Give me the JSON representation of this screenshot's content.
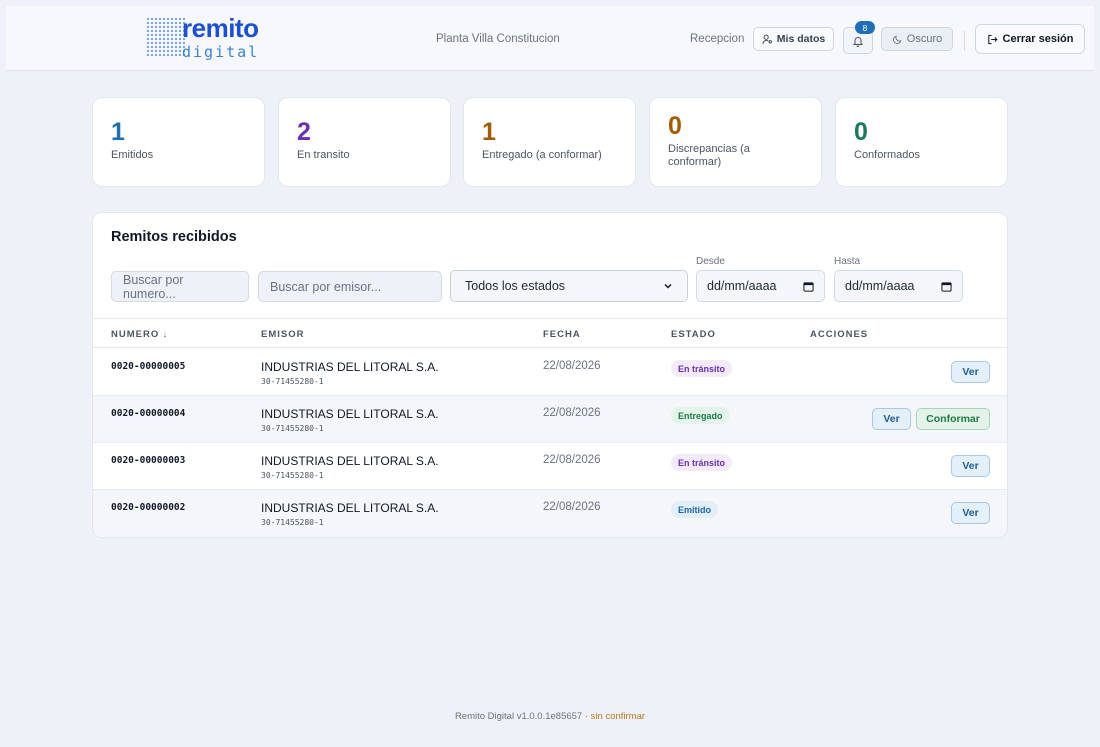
{
  "header": {
    "logo_main": "remito",
    "logo_sub": "digital",
    "plant": "Planta Villa Constitucion",
    "role": "Recepcion",
    "mis_datos": "Mis datos",
    "notifications": "8",
    "theme": "Oscuro",
    "logout": "Cerrar sesión"
  },
  "stats": [
    {
      "value": "1",
      "label": "Emitidos",
      "color": "#1f6fb3"
    },
    {
      "value": "2",
      "label": "En transito",
      "color": "#6b2fb3"
    },
    {
      "value": "1",
      "label": "Entregado (a conformar)",
      "color": "#a15c07"
    },
    {
      "value": "0",
      "label": "Discrepancias (a conformar)",
      "color": "#a15c07"
    },
    {
      "value": "0",
      "label": "Conformados",
      "color": "#1c7a5a"
    }
  ],
  "panel": {
    "title": "Remitos recibidos",
    "search_numero": "Buscar por numero...",
    "search_emisor": "Buscar por emisor...",
    "estado_select": "Todos los estados",
    "desde_label": "Desde",
    "hasta_label": "Hasta",
    "desde_value": "dd/mm/aaaa",
    "hasta_value": "dd/mm/aaaa"
  },
  "table": {
    "headers": {
      "numero": "NUMERO",
      "sort": "↓",
      "emisor": "EMISOR",
      "fecha": "FECHA",
      "estado": "ESTADO",
      "acciones": "ACCIONES"
    },
    "rows": [
      {
        "numero": "0020-00000005",
        "emisor": "INDUSTRIAS DEL LITORAL S.A.",
        "cuit": "30-71455280-1",
        "fecha": "22/08/2026",
        "estado": "En tránsito",
        "ver": "Ver"
      },
      {
        "numero": "0020-00000004",
        "emisor": "INDUSTRIAS DEL LITORAL S.A.",
        "cuit": "30-71455280-1",
        "fecha": "22/08/2026",
        "estado": "Entregado",
        "ver": "Ver",
        "conformar": "Conformar"
      },
      {
        "numero": "0020-00000003",
        "emisor": "INDUSTRIAS DEL LITORAL S.A.",
        "cuit": "30-71455280-1",
        "fecha": "22/08/2026",
        "estado": "En tránsito",
        "ver": "Ver"
      },
      {
        "numero": "0020-00000002",
        "emisor": "INDUSTRIAS DEL LITORAL S.A.",
        "cuit": "30-71455280-1",
        "fecha": "22/08/2026",
        "estado": "Emitido",
        "ver": "Ver"
      }
    ]
  },
  "footer": {
    "version": "Remito Digital v1.0.0.1e85657",
    "status": "· sin confirmar"
  }
}
